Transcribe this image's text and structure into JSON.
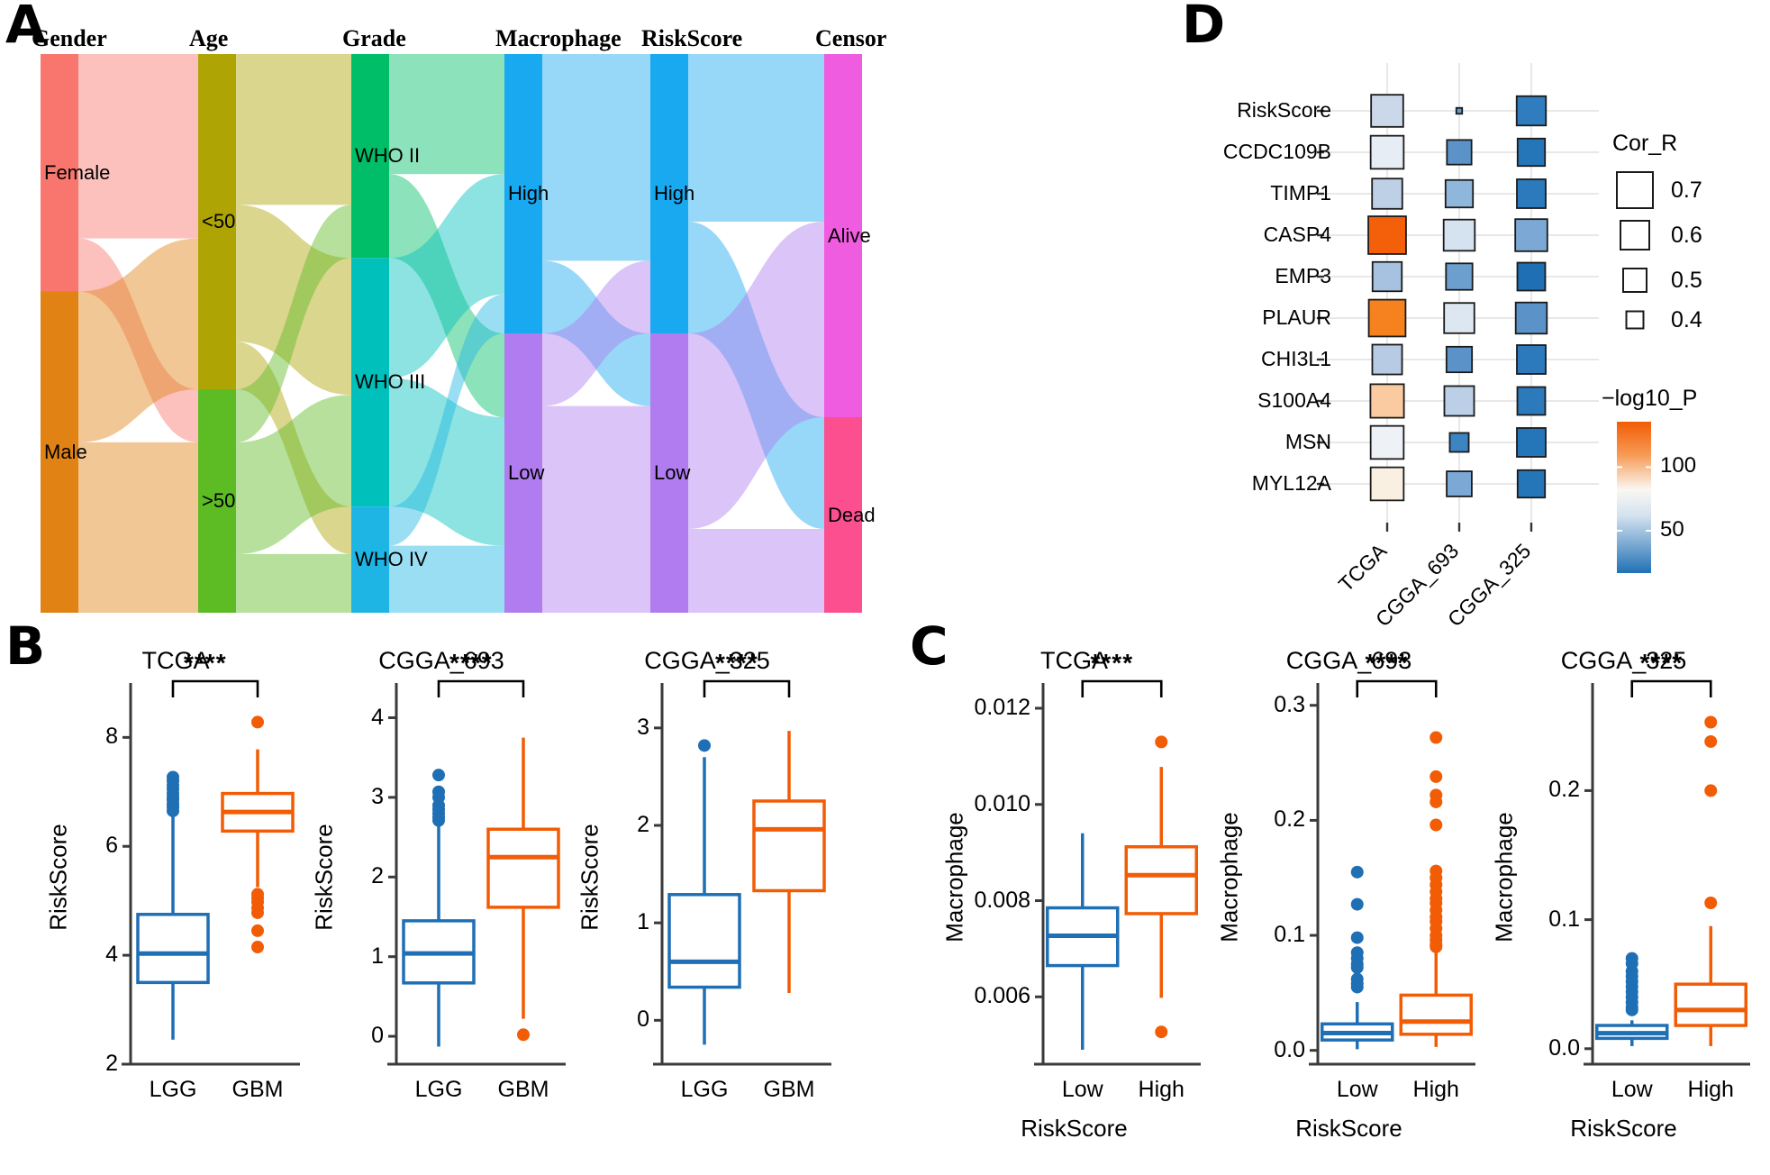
{
  "panels": {
    "a": "A",
    "b": "B",
    "c": "C",
    "d": "D"
  },
  "sankey": {
    "columns": [
      {
        "title": "Gender",
        "nodes": [
          {
            "label": "Female",
            "color": "#F8766D",
            "y": 0.0,
            "h": 0.425
          },
          {
            "label": "Male",
            "color": "#E08214",
            "y": 0.425,
            "h": 0.575
          }
        ]
      },
      {
        "title": "Age",
        "nodes": [
          {
            "label": "<50",
            "color": "#AEA404",
            "y": 0.0,
            "h": 0.6
          },
          {
            "label": ">50",
            "color": "#5DBB24",
            "y": 0.6,
            "h": 0.4
          }
        ]
      },
      {
        "title": "Grade",
        "nodes": [
          {
            "label": "WHO II",
            "color": "#00BE67",
            "y": 0.0,
            "h": 0.365
          },
          {
            "label": "WHO III",
            "color": "#00C0BC",
            "y": 0.365,
            "h": 0.445
          },
          {
            "label": "WHO IV",
            "color": "#1EB5E5",
            "y": 0.81,
            "h": 0.19
          }
        ]
      },
      {
        "title": "Macrophage",
        "nodes": [
          {
            "label": "High",
            "color": "#18A9F0",
            "y": 0.0,
            "h": 0.5
          },
          {
            "label": "Low",
            "color": "#B07CF0",
            "y": 0.5,
            "h": 0.5
          }
        ]
      },
      {
        "title": "RiskScore",
        "nodes": [
          {
            "label": "High",
            "color": "#18A9F0",
            "y": 0.0,
            "h": 0.5
          },
          {
            "label": "Low",
            "color": "#B07CF0",
            "y": 0.5,
            "h": 0.5
          }
        ]
      },
      {
        "title": "Censor",
        "nodes": [
          {
            "label": "Alive",
            "color": "#F05CE0",
            "y": 0.0,
            "h": 0.65
          },
          {
            "label": "Dead",
            "color": "#FC4F90",
            "y": 0.65,
            "h": 0.35
          }
        ]
      }
    ]
  },
  "chart_data": [
    {
      "id": "panelD",
      "type": "heatmap",
      "title": "",
      "xlabel": "",
      "ylabel": "",
      "legend_size_title": "Cor_R",
      "legend_size_values": [
        "0.7",
        "0.6",
        "0.5",
        "0.4"
      ],
      "legend_color_title": "−log10_P",
      "colorbar_ticks": [
        "100",
        "50"
      ],
      "colorbar_range": [
        10,
        140
      ],
      "colorbar_low_color": "#2171B5",
      "colorbar_mid_color": "#FAF7F3",
      "colorbar_high_color": "#F25C05",
      "categories_x": [
        "TCGA",
        "CGGA_693",
        "CGGA_325"
      ],
      "categories_y": [
        "RiskScore",
        "CCDC109B",
        "TIMP1",
        "CASP4",
        "EMP3",
        "PLAUR",
        "CHI3L1",
        "S100A4",
        "MSN",
        "MYL12A"
      ],
      "cells": [
        {
          "y": "RiskScore",
          "x": "TCGA",
          "cor": 0.62,
          "logp": 72,
          "color": "#CBD8EA"
        },
        {
          "y": "RiskScore",
          "x": "CGGA_693",
          "cor": 0.06,
          "logp": 60,
          "color": "#5B9BD1"
        },
        {
          "y": "RiskScore",
          "x": "CGGA_325",
          "cor": 0.56,
          "logp": 35,
          "color": "#2F7DBE"
        },
        {
          "y": "CCDC109B",
          "x": "TCGA",
          "cor": 0.64,
          "logp": 80,
          "color": "#E6EDF4"
        },
        {
          "y": "CCDC109B",
          "x": "CGGA_693",
          "cor": 0.46,
          "logp": 45,
          "color": "#5B93C9"
        },
        {
          "y": "CCDC109B",
          "x": "CGGA_325",
          "cor": 0.52,
          "logp": 32,
          "color": "#2576B8"
        },
        {
          "y": "TIMP1",
          "x": "TCGA",
          "cor": 0.58,
          "logp": 68,
          "color": "#BED0E6"
        },
        {
          "y": "TIMP1",
          "x": "CGGA_693",
          "cor": 0.52,
          "logp": 58,
          "color": "#8FB6DB"
        },
        {
          "y": "TIMP1",
          "x": "CGGA_325",
          "cor": 0.55,
          "logp": 33,
          "color": "#2C79BB"
        },
        {
          "y": "CASP4",
          "x": "TCGA",
          "cor": 0.74,
          "logp": 138,
          "color": "#F4600A"
        },
        {
          "y": "CASP4",
          "x": "CGGA_693",
          "cor": 0.6,
          "logp": 75,
          "color": "#D5E2EF"
        },
        {
          "y": "CASP4",
          "x": "CGGA_325",
          "cor": 0.62,
          "logp": 55,
          "color": "#7BA8D4"
        },
        {
          "y": "EMP3",
          "x": "TCGA",
          "cor": 0.56,
          "logp": 65,
          "color": "#A7C2E0"
        },
        {
          "y": "EMP3",
          "x": "CGGA_693",
          "cor": 0.5,
          "logp": 50,
          "color": "#6C9ECE"
        },
        {
          "y": "EMP3",
          "x": "CGGA_325",
          "cor": 0.53,
          "logp": 30,
          "color": "#1F6FB5"
        },
        {
          "y": "PLAUR",
          "x": "TCGA",
          "cor": 0.72,
          "logp": 128,
          "color": "#F5821F"
        },
        {
          "y": "PLAUR",
          "x": "CGGA_693",
          "cor": 0.58,
          "logp": 78,
          "color": "#DDE7F2"
        },
        {
          "y": "PLAUR",
          "x": "CGGA_325",
          "cor": 0.6,
          "logp": 48,
          "color": "#5B93C9"
        },
        {
          "y": "CHI3L1",
          "x": "TCGA",
          "cor": 0.57,
          "logp": 66,
          "color": "#B7CBE4"
        },
        {
          "y": "CHI3L1",
          "x": "CGGA_693",
          "cor": 0.48,
          "logp": 48,
          "color": "#5B93C9"
        },
        {
          "y": "CHI3L1",
          "x": "CGGA_325",
          "cor": 0.55,
          "logp": 36,
          "color": "#2C79BB"
        },
        {
          "y": "S100A4",
          "x": "TCGA",
          "cor": 0.65,
          "logp": 110,
          "color": "#FACAA0"
        },
        {
          "y": "S100A4",
          "x": "CGGA_693",
          "cor": 0.57,
          "logp": 70,
          "color": "#BBD0E7"
        },
        {
          "y": "S100A4",
          "x": "CGGA_325",
          "cor": 0.53,
          "logp": 33,
          "color": "#2C79BB"
        },
        {
          "y": "MSN",
          "x": "TCGA",
          "cor": 0.64,
          "logp": 82,
          "color": "#EEF2F7"
        },
        {
          "y": "MSN",
          "x": "CGGA_693",
          "cor": 0.34,
          "logp": 42,
          "color": "#3D84C2"
        },
        {
          "y": "MSN",
          "x": "CGGA_325",
          "cor": 0.55,
          "logp": 32,
          "color": "#2576B8"
        },
        {
          "y": "MYL12A",
          "x": "TCGA",
          "cor": 0.64,
          "logp": 92,
          "color": "#FAF0E2"
        },
        {
          "y": "MYL12A",
          "x": "CGGA_693",
          "cor": 0.47,
          "logp": 55,
          "color": "#7BA8D4"
        },
        {
          "y": "MYL12A",
          "x": "CGGA_325",
          "cor": 0.52,
          "logp": 34,
          "color": "#2576B8"
        }
      ]
    },
    {
      "id": "B1",
      "type": "box",
      "title": "TCGA",
      "xlabel": "",
      "ylabel": "RiskScore",
      "ylim": [
        2,
        8.8
      ],
      "yticks": [
        "2",
        "4",
        "6",
        "8"
      ],
      "ytickvals": [
        2,
        4,
        6,
        8
      ],
      "categories": [
        "LGG",
        "GBM"
      ],
      "significance": "****",
      "boxes": [
        {
          "group": "LGG",
          "color": "#1F6FB5",
          "min": 2.45,
          "q1": 3.5,
          "median": 4.03,
          "q3": 4.75,
          "max": 6.55,
          "outliers": [
            6.65,
            6.72,
            6.78,
            6.85,
            6.9,
            6.97,
            7.05,
            7.12,
            7.2,
            7.27
          ]
        },
        {
          "group": "GBM",
          "color": "#F25C05",
          "min": 5.25,
          "q1": 6.28,
          "median": 6.63,
          "q3": 6.97,
          "max": 7.78,
          "outliers": [
            8.28,
            5.12,
            5.05,
            4.98,
            4.87,
            4.78,
            4.45,
            4.15
          ]
        }
      ]
    },
    {
      "id": "B2",
      "type": "box",
      "title": "CGGA_693",
      "xlabel": "",
      "ylabel": "RiskScore",
      "ylim": [
        -0.35,
        4.3
      ],
      "yticks": [
        "0",
        "1",
        "2",
        "3",
        "4"
      ],
      "ytickvals": [
        0,
        1,
        2,
        3,
        4
      ],
      "categories": [
        "LGG",
        "GBM"
      ],
      "significance": "****",
      "boxes": [
        {
          "group": "LGG",
          "color": "#1F6FB5",
          "min": -0.13,
          "q1": 0.67,
          "median": 1.04,
          "q3": 1.45,
          "max": 2.67,
          "outliers": [
            3.28,
            3.07,
            3.0,
            2.9,
            2.85,
            2.8,
            2.75,
            2.71
          ]
        },
        {
          "group": "GBM",
          "color": "#F25C05",
          "min": 0.22,
          "q1": 1.62,
          "median": 2.25,
          "q3": 2.6,
          "max": 3.75,
          "outliers": [
            0.02
          ]
        }
      ]
    },
    {
      "id": "B3",
      "type": "box",
      "title": "CGGA_325",
      "xlabel": "",
      "ylabel": "RiskScore",
      "ylim": [
        -0.45,
        3.35
      ],
      "yticks": [
        "0",
        "1",
        "2",
        "3"
      ],
      "ytickvals": [
        0,
        1,
        2,
        3
      ],
      "categories": [
        "LGG",
        "GBM"
      ],
      "significance": "****",
      "boxes": [
        {
          "group": "LGG",
          "color": "#1F6FB5",
          "min": -0.25,
          "q1": 0.34,
          "median": 0.6,
          "q3": 1.29,
          "max": 2.7,
          "outliers": [
            2.82
          ]
        },
        {
          "group": "GBM",
          "color": "#F25C05",
          "min": 0.28,
          "q1": 1.33,
          "median": 1.96,
          "q3": 2.25,
          "max": 2.97,
          "outliers": []
        }
      ]
    },
    {
      "id": "C1",
      "type": "box",
      "title": "TCGA",
      "xlabel": "RiskScore",
      "ylabel": "Macrophage",
      "ylim": [
        0.0046,
        0.0123
      ],
      "yticks": [
        "0.006",
        "0.008",
        "0.010",
        "0.012"
      ],
      "ytickvals": [
        0.006,
        0.008,
        0.01,
        0.012
      ],
      "categories": [
        "Low",
        "High"
      ],
      "significance": "****",
      "boxes": [
        {
          "group": "Low",
          "color": "#1F6FB5",
          "min": 0.0049,
          "q1": 0.00665,
          "median": 0.00727,
          "q3": 0.00785,
          "max": 0.0094,
          "outliers": []
        },
        {
          "group": "High",
          "color": "#F25C05",
          "min": 0.00598,
          "q1": 0.00773,
          "median": 0.00853,
          "q3": 0.00912,
          "max": 0.01078,
          "outliers": [
            0.0113,
            0.00527
          ]
        }
      ]
    },
    {
      "id": "C2",
      "type": "box",
      "title": "CGGA_693",
      "xlabel": "RiskScore",
      "ylabel": "Macrophage",
      "ylim": [
        -0.012,
        0.31
      ],
      "yticks": [
        "0.0",
        "0.1",
        "0.2",
        "0.3"
      ],
      "ytickvals": [
        0.0,
        0.1,
        0.2,
        0.3
      ],
      "categories": [
        "Low",
        "High"
      ],
      "significance": "****",
      "boxes": [
        {
          "group": "Low",
          "color": "#1F6FB5",
          "min": 0.001,
          "q1": 0.009,
          "median": 0.015,
          "q3": 0.023,
          "max": 0.042,
          "outliers": [
            0.155,
            0.127,
            0.098,
            0.085,
            0.08,
            0.075,
            0.072,
            0.062,
            0.058,
            0.055
          ]
        },
        {
          "group": "High",
          "color": "#F25C05",
          "min": 0.003,
          "q1": 0.014,
          "median": 0.025,
          "q3": 0.048,
          "max": 0.086,
          "outliers": [
            0.272,
            0.238,
            0.222,
            0.216,
            0.196,
            0.156,
            0.15,
            0.144,
            0.138,
            0.132,
            0.128,
            0.122,
            0.116,
            0.112,
            0.106,
            0.1,
            0.096,
            0.092,
            0.09
          ]
        }
      ]
    },
    {
      "id": "C3",
      "type": "box",
      "title": "CGGA_325",
      "xlabel": "RiskScore",
      "ylabel": "Macrophage",
      "ylim": [
        -0.012,
        0.275
      ],
      "yticks": [
        "0.0",
        "0.1",
        "0.2"
      ],
      "ytickvals": [
        0.0,
        0.1,
        0.2
      ],
      "categories": [
        "Low",
        "High"
      ],
      "significance": "****",
      "boxes": [
        {
          "group": "Low",
          "color": "#1F6FB5",
          "min": 0.002,
          "q1": 0.008,
          "median": 0.012,
          "q3": 0.018,
          "max": 0.022,
          "outliers": [
            0.07,
            0.066,
            0.06,
            0.056,
            0.052,
            0.048,
            0.044,
            0.04,
            0.036,
            0.032,
            0.03
          ]
        },
        {
          "group": "High",
          "color": "#F25C05",
          "min": 0.002,
          "q1": 0.018,
          "median": 0.03,
          "q3": 0.05,
          "max": 0.095,
          "outliers": [
            0.253,
            0.238,
            0.2,
            0.113
          ]
        }
      ]
    }
  ]
}
